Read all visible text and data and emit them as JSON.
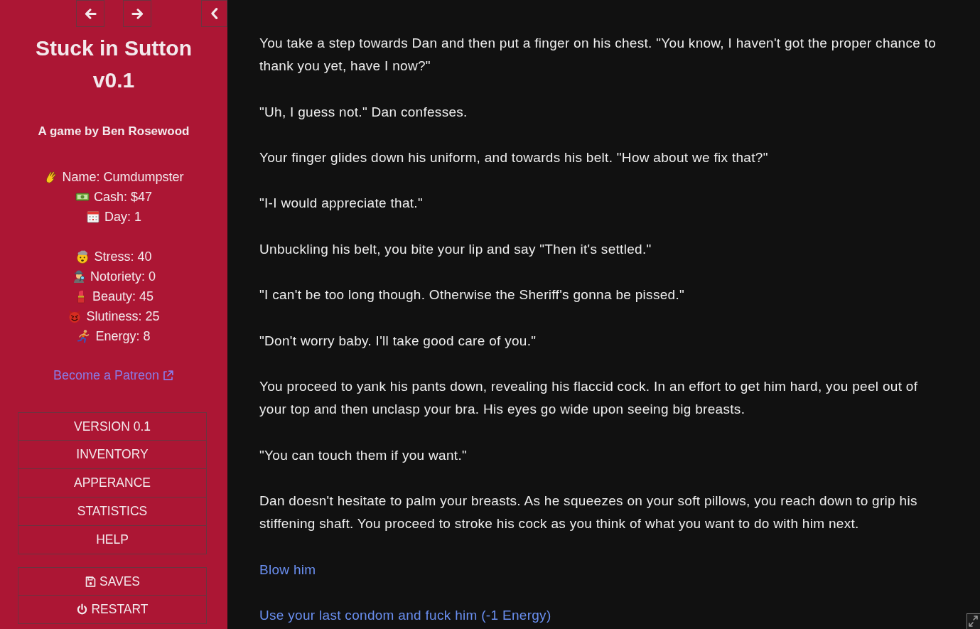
{
  "sidebar": {
    "title": "Stuck in Sutton v0.1",
    "byline": "A game by Ben Rosewood",
    "stat_groups": [
      [
        "Name: Cumdumpster",
        "Cash: $47",
        "Day: 1"
      ],
      [
        "Stress: 40",
        "Notoriety: 0",
        "Beauty: 45",
        "Slutiness: 25",
        "Energy: 8"
      ]
    ],
    "patreon_link": "Become a Patreon",
    "menu": [
      "VERSION 0.1",
      "INVENTORY",
      "APPERANCE",
      "STATISTICS",
      "HELP"
    ],
    "actions": [
      "SAVES",
      "RESTART"
    ]
  },
  "passage": {
    "paragraphs": [
      "You take a step towards Dan and then put a finger on his chest. \"You know, I haven't got the proper chance to thank you yet, have I now?\"",
      "\"Uh, I guess not.\" Dan confesses.",
      "Your finger glides down his uniform, and towards his belt. \"How about we fix that?\"",
      "\"I-I would appreciate that.\"",
      "Unbuckling his belt, you bite your lip and say \"Then it's settled.\"",
      "\"I can't be too long though. Otherwise the Sheriff's gonna be pissed.\"",
      "\"Don't worry baby. I'll take good care of you.\"",
      "You proceed to yank his pants down, revealing his flaccid cock. In an effort to get him hard, you peel out of your top and then unclasp your bra. His eyes go wide upon seeing big breasts.",
      "\"You can touch them if you want.\"",
      "Dan doesn't hesitate to palm your breasts. As he squeezes on your soft pillows, you reach down to grip his stiffening shaft. You proceed to stroke his cock as you think of what you want to do with him next."
    ],
    "choices": [
      "Blow him",
      "Use your last condom and fuck him (-1 Energy)"
    ]
  }
}
